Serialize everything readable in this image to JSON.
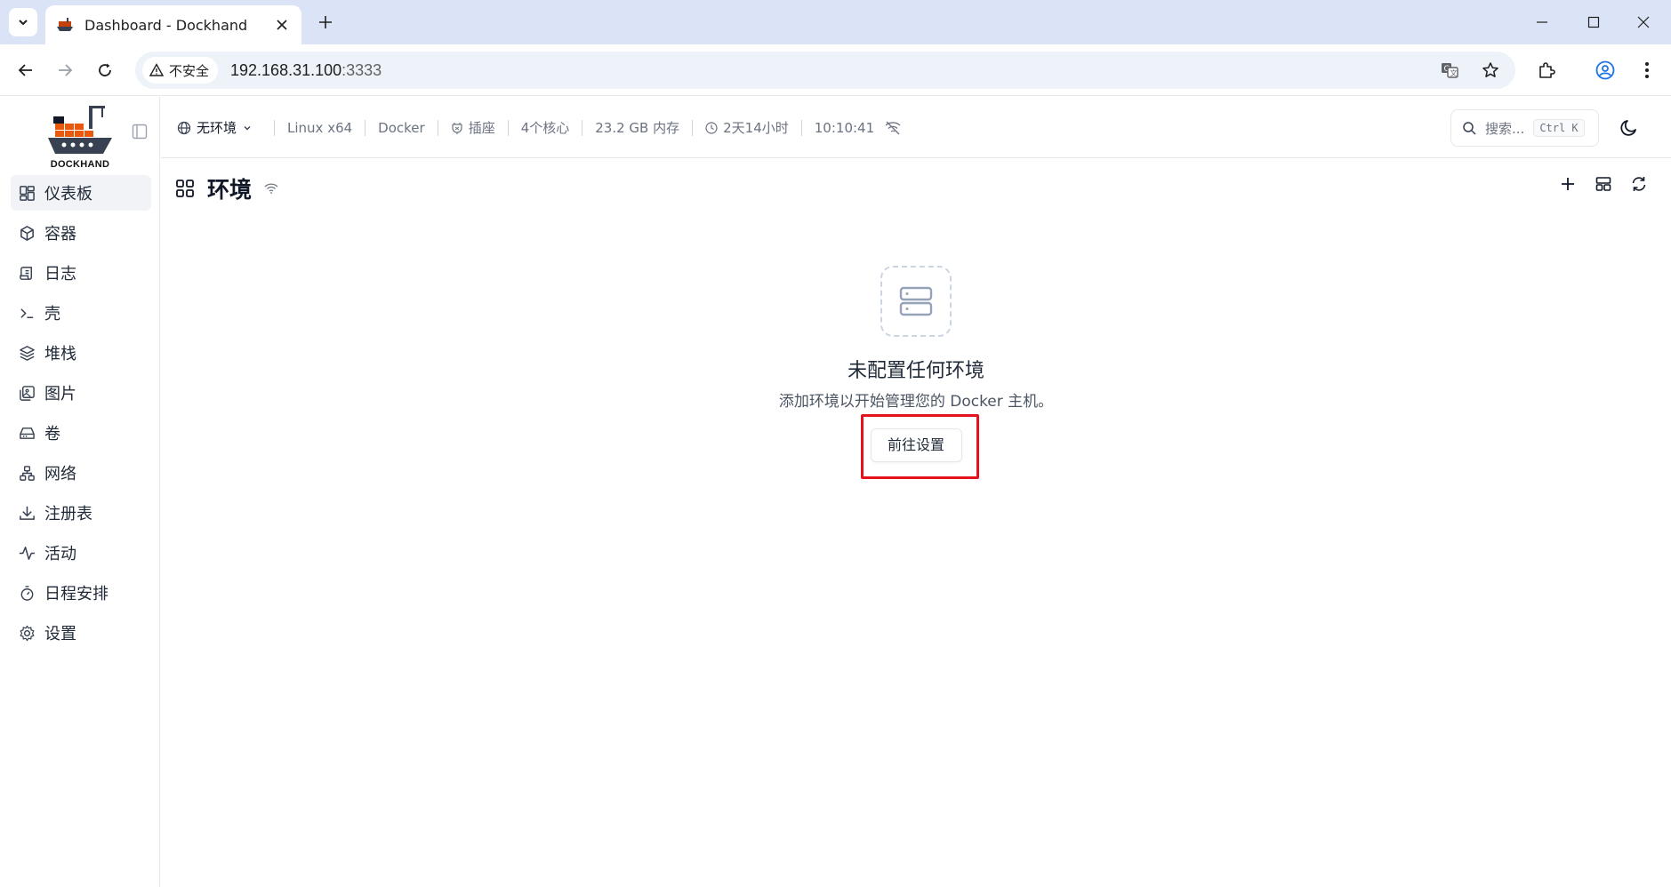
{
  "browser": {
    "tab_title": "Dashboard - Dockhand",
    "security_label": "不安全",
    "url_host": "192.168.31.100",
    "url_port": ":3333"
  },
  "app": {
    "logo_text": "DOCKHAND",
    "sidebar": {
      "items": [
        {
          "label": "仪表板",
          "icon": "dashboard-icon",
          "active": true
        },
        {
          "label": "容器",
          "icon": "box-icon"
        },
        {
          "label": "日志",
          "icon": "scroll-icon"
        },
        {
          "label": "壳",
          "icon": "terminal-icon"
        },
        {
          "label": "堆栈",
          "icon": "layers-icon"
        },
        {
          "label": "图片",
          "icon": "images-icon"
        },
        {
          "label": "卷",
          "icon": "hard-drive-icon"
        },
        {
          "label": "网络",
          "icon": "network-icon"
        },
        {
          "label": "注册表",
          "icon": "download-icon"
        },
        {
          "label": "活动",
          "icon": "activity-icon"
        },
        {
          "label": "日程安排",
          "icon": "timer-icon"
        },
        {
          "label": "设置",
          "icon": "gear-icon"
        }
      ]
    },
    "header": {
      "env_label": "无环境",
      "os": "Linux x64",
      "engine": "Docker",
      "connection": "插座",
      "cores": "4个核心",
      "memory": "23.2 GB 内存",
      "uptime": "2天14小时",
      "time": "10:10:41",
      "search_placeholder": "搜索...",
      "search_shortcut": "Ctrl K"
    },
    "page": {
      "title": "环境",
      "empty_title": "未配置任何环境",
      "empty_desc": "添加环境以开始管理您的 Docker 主机。",
      "goto_button": "前往设置"
    }
  },
  "colors": {
    "highlight": "#e3121b",
    "tabstrip": "#dbe4f6"
  }
}
